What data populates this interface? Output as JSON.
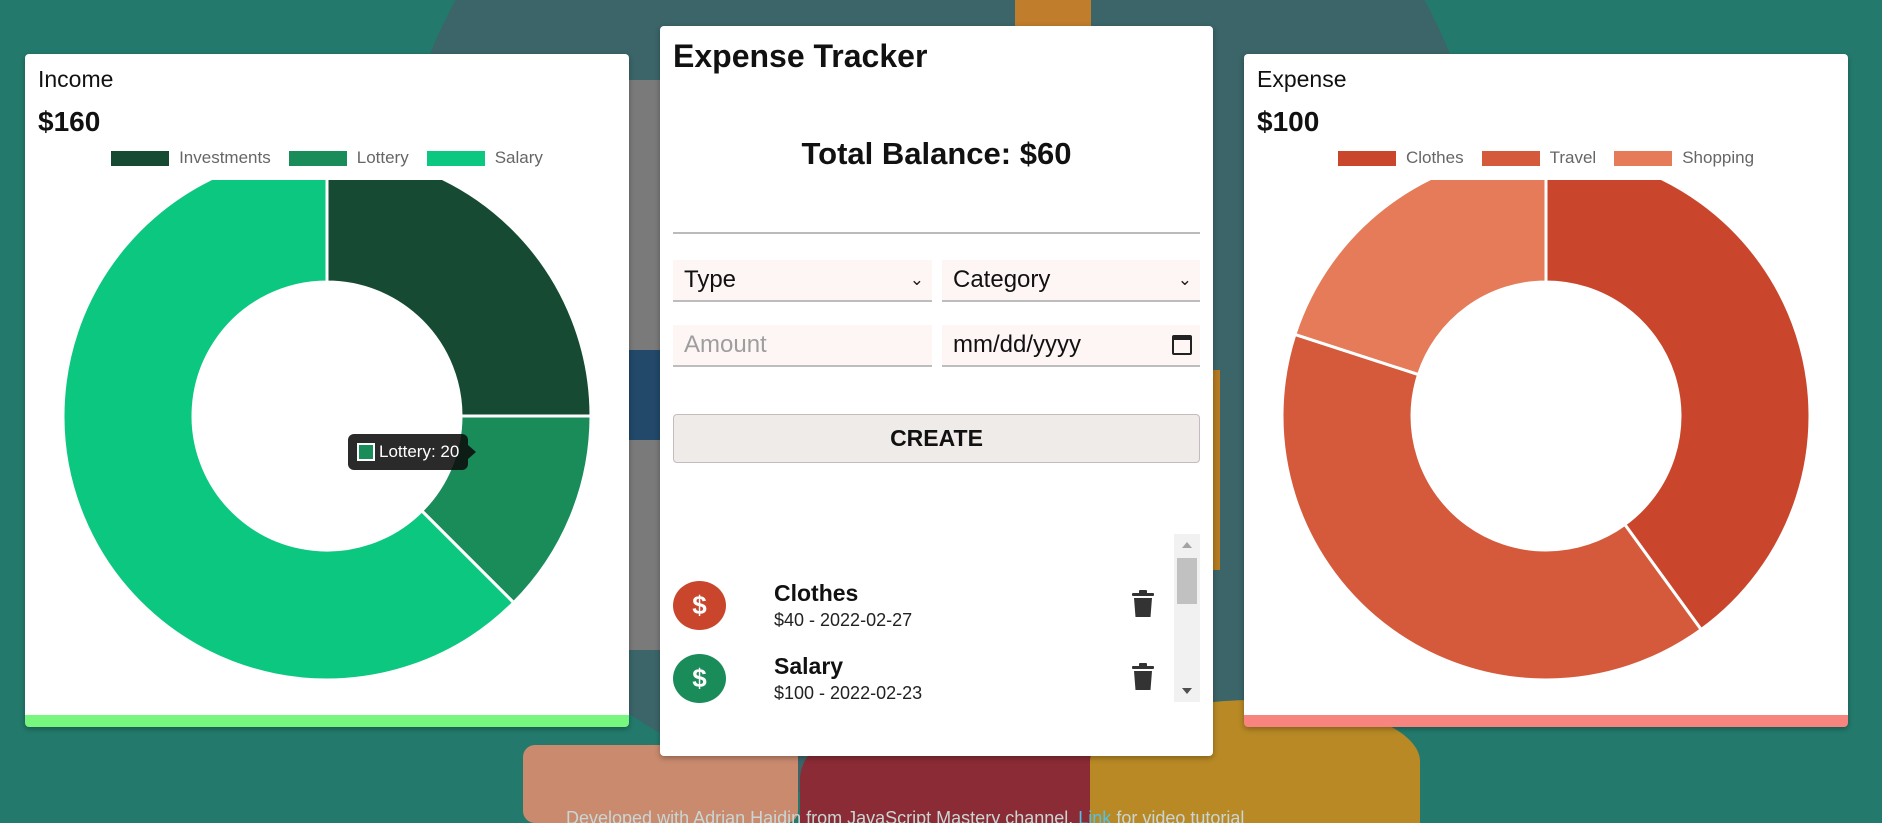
{
  "colors": {
    "background": "#237a6c",
    "income_bar": "#77f77d",
    "expense_bar": "#f88480"
  },
  "income": {
    "title": "Income",
    "amount": "$160",
    "chart_data": {
      "type": "pie",
      "categories": [
        "Investments",
        "Lottery",
        "Salary"
      ],
      "values": [
        40,
        20,
        100
      ],
      "colors": [
        "#174a33",
        "#1a8c5a",
        "#0cc77f"
      ],
      "legend": "top"
    }
  },
  "expense": {
    "title": "Expense",
    "amount": "$100",
    "chart_data": {
      "type": "pie",
      "categories": [
        "Clothes",
        "Travel",
        "Shopping"
      ],
      "values": [
        40,
        40,
        20
      ],
      "colors": [
        "#c9462d",
        "#d45a3b",
        "#e57b58"
      ],
      "legend": "top"
    }
  },
  "tooltip": {
    "label": "Lottery: 20"
  },
  "tracker": {
    "title": "Expense Tracker",
    "balance": "Total Balance: $60",
    "type_select": "Type",
    "category_select": "Category",
    "amount_placeholder": "Amount",
    "date_placeholder": "mm/dd/yyyy",
    "create_label": "CREATE",
    "transactions": [
      {
        "name": "Clothes",
        "detail": "$40 - 2022-02-27",
        "icon": "dollar-icon",
        "color": "#c9462d"
      },
      {
        "name": "Salary",
        "detail": "$100 - 2022-02-23",
        "icon": "dollar-icon",
        "color": "#1a8c5a"
      }
    ]
  },
  "footer": {
    "prefix": "Developed with Adrian Hajdin from JavaScript Mastery channel.",
    "link": "Link",
    "suffix": "for video tutorial"
  }
}
